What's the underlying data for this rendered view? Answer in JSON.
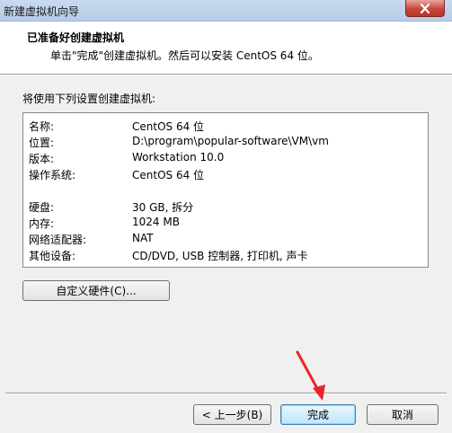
{
  "window": {
    "title": "新建虚拟机向导",
    "close_icon": "close-icon"
  },
  "header": {
    "title": "已准备好创建虚拟机",
    "subtitle": "单击\"完成\"创建虚拟机。然后可以安装 CentOS 64 位。"
  },
  "summary": {
    "label": "将使用下列设置创建虚拟机:",
    "rows": [
      {
        "key": "名称:",
        "value": "CentOS 64 位"
      },
      {
        "key": "位置:",
        "value": "D:\\program\\popular-software\\VM\\vm"
      },
      {
        "key": "版本:",
        "value": "Workstation 10.0"
      },
      {
        "key": "操作系统:",
        "value": "CentOS 64 位"
      },
      {
        "key": "硬盘:",
        "value": "30 GB, 拆分"
      },
      {
        "key": "内存:",
        "value": "1024 MB"
      },
      {
        "key": "网络适配器:",
        "value": "NAT"
      },
      {
        "key": "其他设备:",
        "value": "CD/DVD, USB 控制器, 打印机, 声卡"
      }
    ]
  },
  "buttons": {
    "customize": "自定义硬件(C)...",
    "back": "< 上一步(B)",
    "finish": "完成",
    "cancel": "取消"
  },
  "colors": {
    "accent_arrow": "#e8262a",
    "header_bg": "#ffffff",
    "window_bg": "#f0f0f0"
  }
}
